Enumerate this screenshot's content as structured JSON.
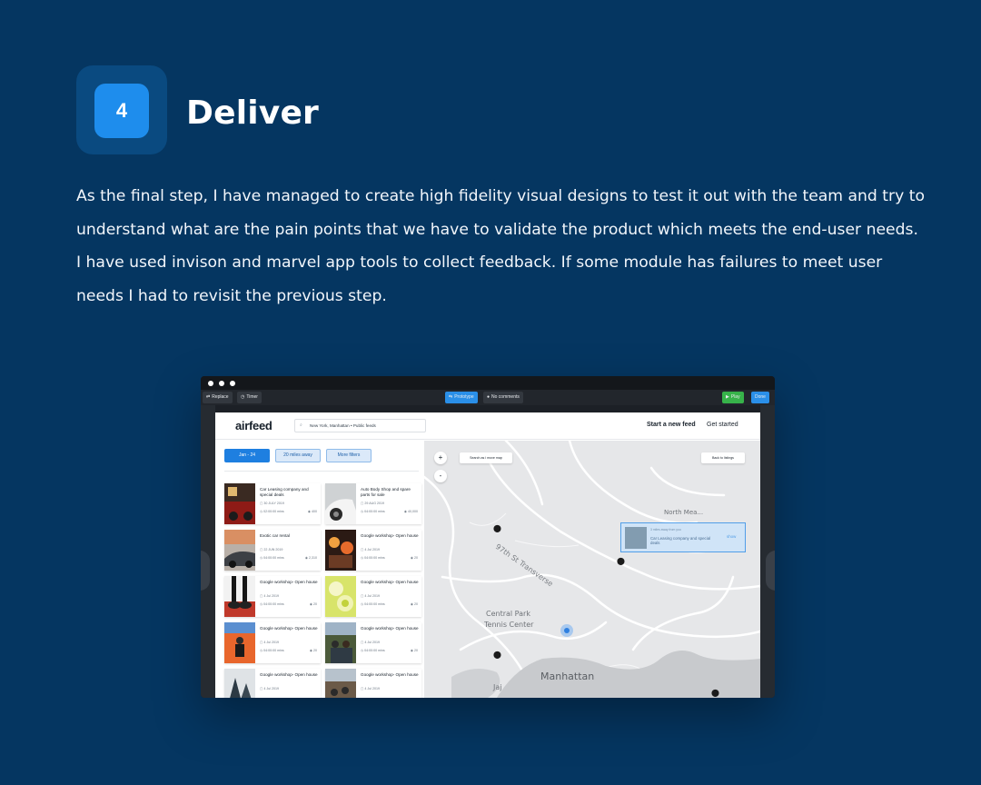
{
  "step": {
    "number": "4",
    "title": "Deliver"
  },
  "description": {
    "lines": [
      "As the final step, I have managed to create high fidelity visual designs to test it out with the team and try to",
      "understand what are the pain points that we have to validate the product which meets the end-user needs.",
      "I have used invison and marvel app tools to collect feedback.  If some module has failures to meet user",
      "needs I had to revisit the previous step."
    ]
  },
  "toolbar": {
    "replace_label": "Replace",
    "timer_label": "Timer",
    "prototype_label": "Prototype",
    "comments_label": "No comments",
    "play_label": "Play",
    "done_label": "Done"
  },
  "app": {
    "logo": "airfeed",
    "search_value": "New York, Manhattan • Public feeds",
    "nav": {
      "start_feed": "Start a new feed",
      "get_started": "Get started"
    },
    "filters": [
      "Jan - 24",
      "20 miles away",
      "More filters"
    ],
    "cards": [
      {
        "title": "Car Leasing company and special deals",
        "date": "30 JULY 2019",
        "time": "02:00:00 mins",
        "views": "400"
      },
      {
        "title": "Auto Body Shop and spare parts for sale",
        "date": "29 AUG 2019",
        "time": "04:00:00 mins",
        "views": "40,000"
      },
      {
        "title": "Exotic car rental",
        "date": "22 JUN 2019",
        "time": "04:00:00 mins",
        "views": "2,310"
      },
      {
        "title": "Google workshop- Open house",
        "date": "4 Jul 2019",
        "time": "04:00:00 mins",
        "views": "20"
      },
      {
        "title": "Google workshop- Open house",
        "date": "4 Jul 2019",
        "time": "04:00:00 mins",
        "views": "20"
      },
      {
        "title": "Google workshop- Open house",
        "date": "4 Jul 2019",
        "time": "04:00:00 mins",
        "views": "20"
      },
      {
        "title": "Google workshop- Open house",
        "date": "4 Jul 2019",
        "time": "04:00:00 mins",
        "views": "20"
      },
      {
        "title": "Google workshop- Open house",
        "date": "4 Jul 2019",
        "time": "04:00:00 mins",
        "views": "20"
      },
      {
        "title": "Google workshop- Open house",
        "date": "4 Jul 2019",
        "time": "",
        "views": ""
      },
      {
        "title": "Google workshop- Open house",
        "date": "4 Jul 2019",
        "time": "",
        "views": ""
      }
    ],
    "map": {
      "zoom_in": "+",
      "zoom_out": "-",
      "search_as_move": "Search as i move map",
      "back_to_listings": "Back to listings",
      "labels": {
        "street": "97th St Transverse",
        "tennis_1": "Central Park",
        "tennis_2": "Tennis Center",
        "manhattan": "Manhattan",
        "jaj": "Jaj",
        "north_meadow": "North Mea..."
      },
      "popup": {
        "distance": "3 miles away from you",
        "title": "Car Leasing company and special deals",
        "action": "show"
      }
    }
  },
  "colors": {
    "background": "#053661",
    "badge": "#1e8ded",
    "accent_blue": "#1e7fe0",
    "play_green": "#37b34a"
  }
}
